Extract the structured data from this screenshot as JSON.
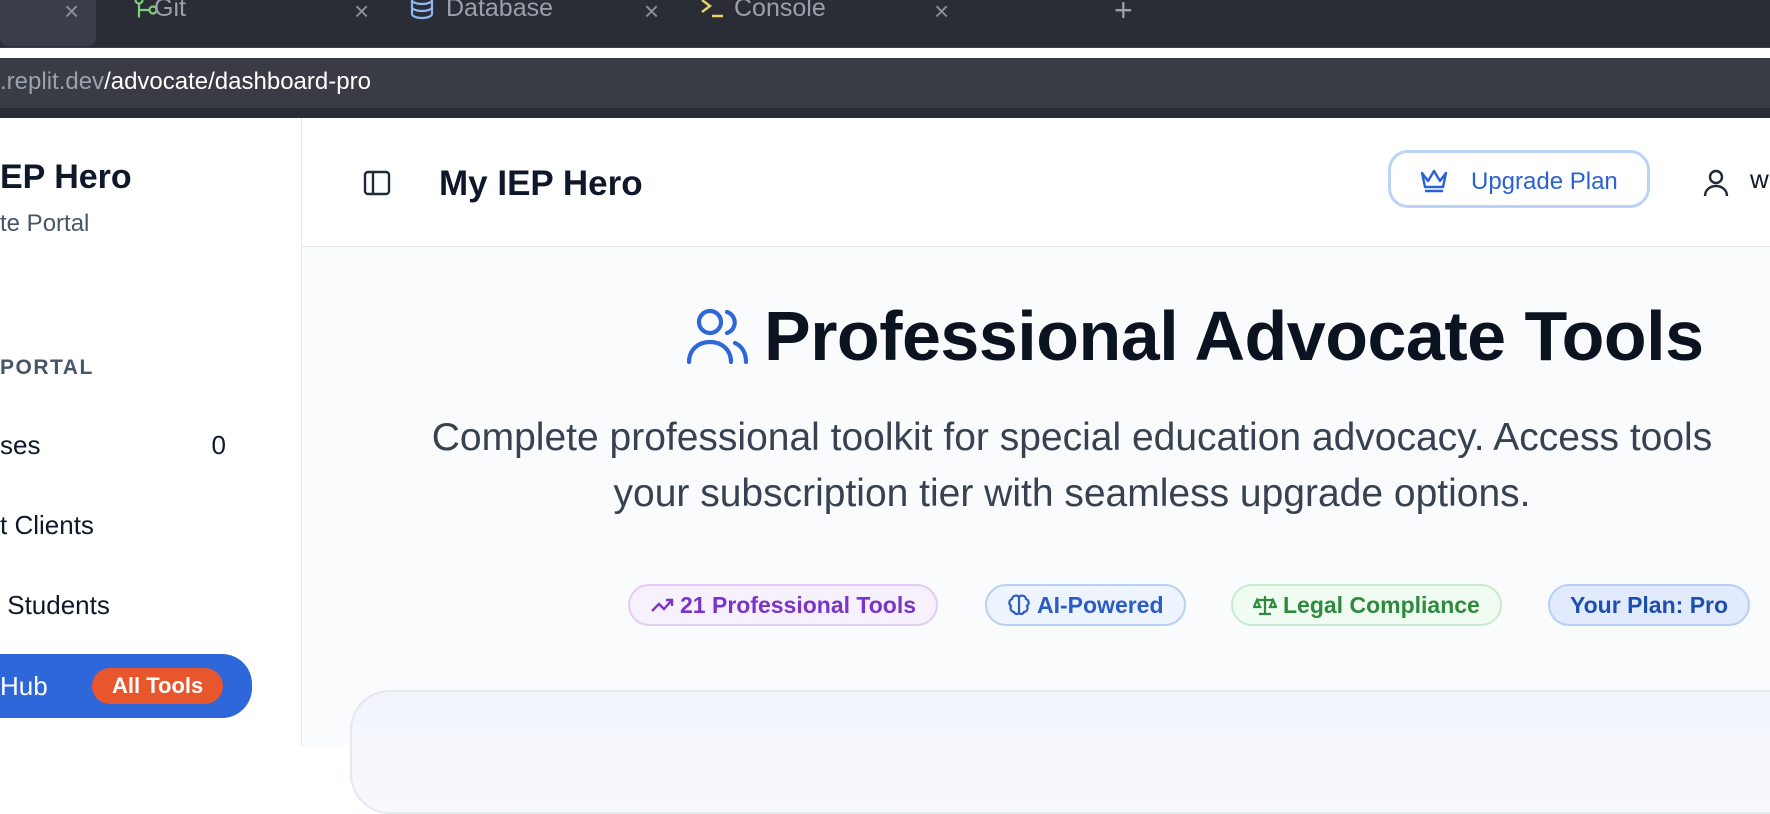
{
  "browser": {
    "tabs": [
      {
        "label": "Git",
        "icon": "git-branch-icon"
      },
      {
        "label": "Database",
        "icon": "database-icon"
      },
      {
        "label": "Console",
        "icon": "terminal-icon"
      }
    ],
    "close_glyph": "×",
    "new_tab_glyph": "+",
    "url_host": ".replit.dev",
    "url_path": "/advocate/dashboard-pro"
  },
  "sidebar": {
    "brand_name": "EP Hero",
    "brand_sub": "te Portal",
    "section_label": "PORTAL",
    "items": [
      {
        "label": "ses",
        "count": "0"
      },
      {
        "label": "t Clients"
      },
      {
        "label": " Students"
      },
      {
        "label": "Hub",
        "badge": "All Tools"
      }
    ]
  },
  "header": {
    "title": "My IEP Hero",
    "upgrade_label": "Upgrade Plan",
    "user_label": "w"
  },
  "hero": {
    "title": "Professional Advocate Tools",
    "description_line1": "Complete professional toolkit for special education advocacy. Access tools",
    "description_line2": "your subscription tier with seamless upgrade options.",
    "pills": [
      {
        "label": "21 Professional Tools",
        "icon": "trending-up-icon"
      },
      {
        "label": "AI-Powered",
        "icon": "brain-icon"
      },
      {
        "label": "Legal Compliance",
        "icon": "scale-icon"
      },
      {
        "label": "Your Plan: Pro"
      }
    ]
  },
  "colors": {
    "accent": "#2e67d9",
    "badge": "#e8562e",
    "chrome": "#2a2d36"
  }
}
